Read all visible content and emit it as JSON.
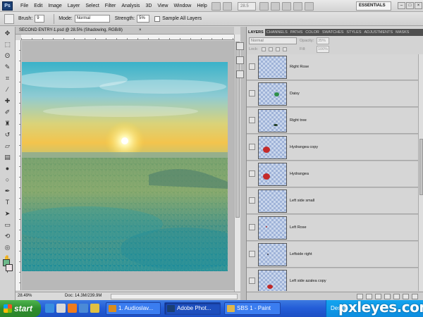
{
  "app": {
    "logo": "Ps",
    "menu": [
      "File",
      "Edit",
      "Image",
      "Layer",
      "Select",
      "Filter",
      "Analysis",
      "3D",
      "View",
      "Window",
      "Help"
    ],
    "zoom_display": "28.5",
    "workspace": "ESSENTIALS",
    "window_controls": [
      "–",
      "□",
      "×"
    ]
  },
  "options_bar": {
    "brush_label": "Brush:",
    "brush_size": "9",
    "mode_label": "Mode:",
    "mode_value": "Normal",
    "strength_label": "Strength:",
    "strength_value": "5%",
    "sample_all_layers": "Sample All Layers"
  },
  "document": {
    "tab_title": "SECOND ENTRY-1.psd @ 28.5% (Shadowing, RGB/8)",
    "zoom_level": "28.49%",
    "doc_size": "Doc: 14.3M/239.9M"
  },
  "colors": {
    "foreground": "#6fb98b",
    "background": "#f0e4e8"
  },
  "layers_panel": {
    "tabs": [
      "LAYERS",
      "CHANNELS",
      "PATHS",
      "COLOR",
      "SWATCHES",
      "STYLES",
      "ADJUSTMENTS",
      "MASKS"
    ],
    "blend_mode": "Normal",
    "opacity_label": "Opacity:",
    "opacity_value": "35%",
    "lock_label": "Lock:",
    "fill_label": "Fill:",
    "fill_value": "100%",
    "layers": [
      {
        "name": "Right Rose",
        "mark": "none"
      },
      {
        "name": "Daisy",
        "mark": "green-daisy"
      },
      {
        "name": "Right tree",
        "mark": "small-tree"
      },
      {
        "name": "Hydrangea copy",
        "mark": "red-hydrangea"
      },
      {
        "name": "Hydrangea",
        "mark": "red-hydrangea"
      },
      {
        "name": "Left side small",
        "mark": "none"
      },
      {
        "name": "Left Rose",
        "mark": "tiny-red"
      },
      {
        "name": "Leftside right",
        "mark": "tiny-dark"
      },
      {
        "name": "Left side azalea copy",
        "mark": "red-azalea"
      }
    ]
  },
  "taskbar": {
    "start_label": "start",
    "tasks": [
      {
        "label": "1. Audioslav...",
        "icon_color": "#d98c1f",
        "active": false
      },
      {
        "label": "Adobe Phot...",
        "icon_color": "#1a3f74",
        "active": true
      },
      {
        "label": "SBS 1 - Paint",
        "icon_color": "#e0b64a",
        "active": false
      }
    ],
    "tray_label": "Deskt"
  },
  "watermark": "pxleyes.com"
}
